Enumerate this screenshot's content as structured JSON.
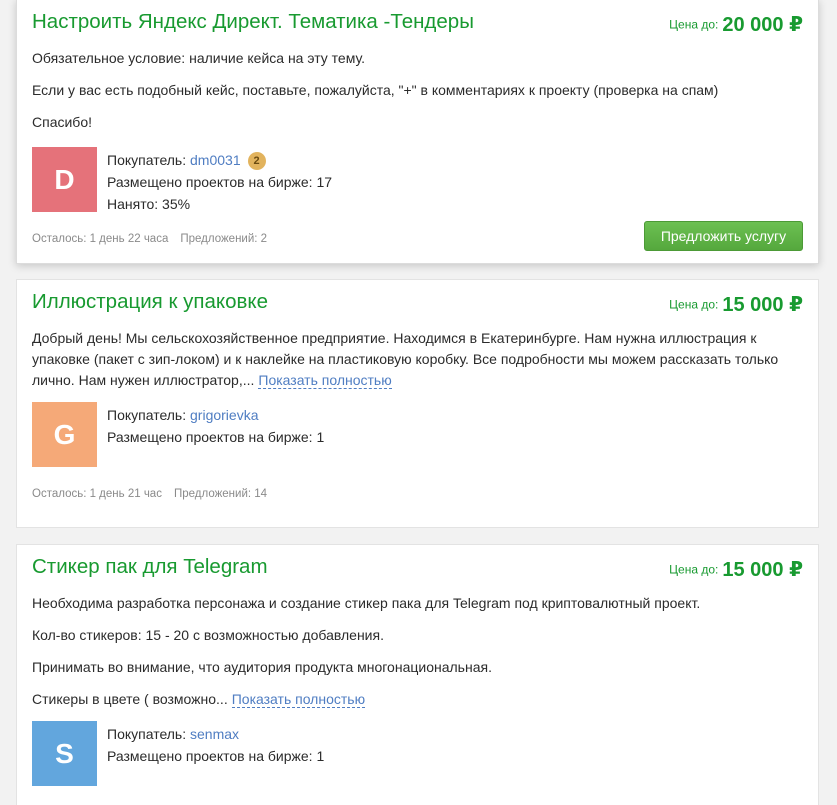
{
  "projects": [
    {
      "title": "Настроить Яндекс Директ. Тематика -Тендеры",
      "price_label": "Цена до:",
      "price": "20 000 ₽",
      "description": [
        "Обязательное условие: наличие кейса на эту тему.",
        "Если у вас есть подобный кейс, поставьте, пожалуйста, \"+\" в комментариях к проекту (проверка на спам)",
        "Спасибо!"
      ],
      "buyer_label": "Покупатель:",
      "buyer_name": "dm0031",
      "buyer_badge": "2",
      "avatar_letter": "D",
      "avatar_color": "#e5727a",
      "projects_posted": "Размещено проектов на бирже: 17",
      "hired": "Нанято: 35%",
      "time_left": "Осталось: 1 день 22 часа",
      "offers": "Предложений: 2",
      "offer_button": "Предложить услугу"
    },
    {
      "title": "Иллюстрация к упаковке",
      "price_label": "Цена до:",
      "price": "15 000 ₽",
      "description_text": "Добрый день! Мы сельскохозяйственное предприятие. Находимся в Екатеринбурге. Нам нужна иллюстрация к упаковке (пакет с зип-локом) и к наклейке на пластиковую коробку. Все подробности мы можем рассказать только лично. Нам нужен иллюстратор,...",
      "show_more": "Показать полностью",
      "buyer_label": "Покупатель:",
      "buyer_name": "grigorievka",
      "avatar_letter": "G",
      "avatar_color": "#f5a978",
      "projects_posted": "Размещено проектов на бирже: 1",
      "time_left": "Осталось: 1 день 21 час",
      "offers": "Предложений: 14"
    },
    {
      "title": "Стикер пак для Telegram",
      "price_label": "Цена до:",
      "price": "15 000 ₽",
      "description": [
        "Необходима разработка персонажа и создание стикер пака для Telegram под криптовалютный проект.",
        "Кол-во стикеров: 15 - 20 с возможностью добавления.",
        "Принимать во внимание, что аудитория продукта многонациональная."
      ],
      "description_tail": "Стикеры в цвете ( возможно...",
      "show_more": "Показать полностью",
      "buyer_label": "Покупатель:",
      "buyer_name": "senmax",
      "avatar_letter": "S",
      "avatar_color": "#62a6dd",
      "projects_posted": "Размещено проектов на бирже: 1"
    }
  ],
  "colors": {
    "title_green": "#189a30",
    "link_blue": "#4f7dc2",
    "button_green": "#5cb343",
    "meta_gray": "#8a8a8a"
  }
}
